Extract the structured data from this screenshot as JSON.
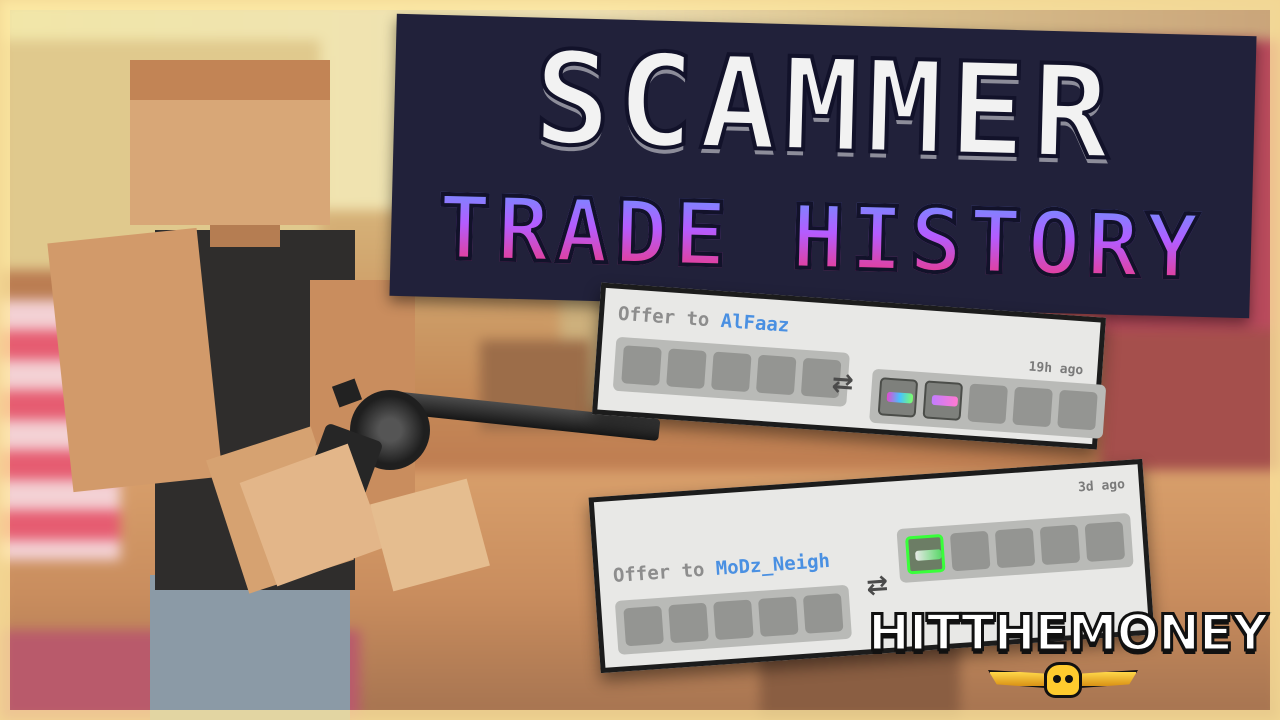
{
  "title": {
    "line1": "SCAMMER",
    "line2": "TRADE HISTORY"
  },
  "trades": [
    {
      "prefix": "Offer to ",
      "user": "AlFaaz",
      "time": "19h ago",
      "swap_icon": "swap-arrows-icon"
    },
    {
      "prefix": "Offer to ",
      "user": "MoDz_Neigh",
      "time": "3d ago",
      "swap_icon": "swap-arrows-icon"
    }
  ],
  "logo": {
    "text": "HITTHEMONEY"
  },
  "colors": {
    "username": "#4a90e2",
    "highlight": "#39ff3a",
    "title_bg": "#21213a"
  }
}
